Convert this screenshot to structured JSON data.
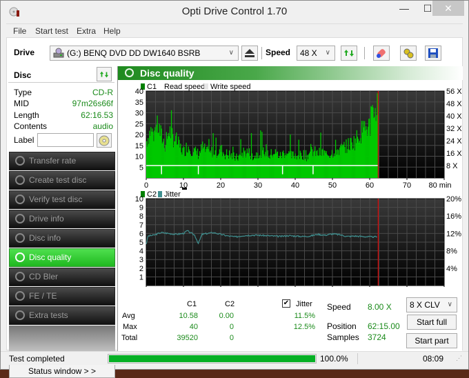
{
  "window": {
    "title": "Opti Drive Control 1.70",
    "controls": {
      "minimize": "—",
      "maximize": "☐",
      "close": "✕"
    }
  },
  "menu": [
    "File",
    "Start test",
    "Extra",
    "Help"
  ],
  "toolbar": {
    "drive_label": "Drive",
    "drive_value": "(G:)  BENQ DVD DD DW1640 BSRB",
    "speed_label": "Speed",
    "speed_value": "48 X",
    "icons": [
      "eject-icon",
      "refresh-icon",
      "erase-icon",
      "settings-icon",
      "save-icon"
    ]
  },
  "disc": {
    "header": "Disc",
    "fields": [
      {
        "key": "Type",
        "value": "CD-R"
      },
      {
        "key": "MID",
        "value": "97m26s66f"
      },
      {
        "key": "Length",
        "value": "62:16.53"
      },
      {
        "key": "Contents",
        "value": "audio"
      }
    ],
    "label_key": "Label",
    "label_value": ""
  },
  "nav": [
    {
      "label": "Transfer rate",
      "active": false
    },
    {
      "label": "Create test disc",
      "active": false
    },
    {
      "label": "Verify test disc",
      "active": false
    },
    {
      "label": "Drive info",
      "active": false
    },
    {
      "label": "Disc info",
      "active": false
    },
    {
      "label": "Disc quality",
      "active": true
    },
    {
      "label": "CD Bler",
      "active": false
    },
    {
      "label": "FE / TE",
      "active": false
    },
    {
      "label": "Extra tests",
      "active": false
    }
  ],
  "status_window_button": "Status window > >",
  "panel_title": "Disc quality",
  "chart_data": [
    {
      "type": "bar",
      "title": "C1",
      "legend": [
        "C1",
        "Read speed",
        "Write speed"
      ],
      "legend_colors": {
        "C1": "#00c000",
        "Read speed": "#ffffff",
        "Write speed": "#e6e6e6"
      },
      "xlabel": "min",
      "x_ticks": [
        "0",
        "10",
        "20",
        "30",
        "40",
        "50",
        "60",
        "70",
        "80 min"
      ],
      "xlim": [
        0,
        80
      ],
      "y_left_ticks": [
        "5",
        "10",
        "15",
        "20",
        "25",
        "30",
        "35",
        "40"
      ],
      "ylim_left": [
        0,
        40
      ],
      "y_right_ticks": [
        "8 X",
        "16 X",
        "24 X",
        "32 X",
        "40 X",
        "48 X",
        "56 X"
      ],
      "ylim_right": [
        0,
        56
      ],
      "end_marker_min": 62.28,
      "read_speed_x": 8,
      "read_speed_dips_min": [
        4.1,
        14.0,
        36.6,
        44.8
      ],
      "c1_envelope": [
        [
          0,
          17
        ],
        [
          1,
          22
        ],
        [
          2,
          20
        ],
        [
          3,
          24
        ],
        [
          4,
          19
        ],
        [
          5,
          15
        ],
        [
          6,
          22
        ],
        [
          7,
          19
        ],
        [
          8,
          17
        ],
        [
          9,
          14
        ],
        [
          10,
          12
        ],
        [
          11,
          15
        ],
        [
          12,
          13
        ],
        [
          13,
          12
        ],
        [
          14,
          11
        ],
        [
          15,
          14
        ],
        [
          16,
          12
        ],
        [
          17,
          11
        ],
        [
          18,
          13
        ],
        [
          19,
          12
        ],
        [
          20,
          13
        ],
        [
          21,
          11
        ],
        [
          22,
          11
        ],
        [
          23,
          10
        ],
        [
          24,
          9
        ],
        [
          25,
          10
        ],
        [
          26,
          12
        ],
        [
          27,
          12
        ],
        [
          28,
          11
        ],
        [
          29,
          10
        ],
        [
          30,
          12
        ],
        [
          31,
          11
        ],
        [
          32,
          13
        ],
        [
          33,
          10
        ],
        [
          34,
          12
        ],
        [
          35,
          11
        ],
        [
          36,
          10
        ],
        [
          37,
          12
        ],
        [
          38,
          11
        ],
        [
          39,
          10
        ],
        [
          40,
          11
        ],
        [
          41,
          10
        ],
        [
          42,
          11
        ],
        [
          43,
          10
        ],
        [
          44,
          12
        ],
        [
          45,
          12
        ],
        [
          46,
          11
        ],
        [
          47,
          12
        ],
        [
          48,
          11
        ],
        [
          49,
          11
        ],
        [
          50,
          12
        ],
        [
          51,
          13
        ],
        [
          52,
          13
        ],
        [
          53,
          14
        ],
        [
          54,
          15
        ],
        [
          55,
          16
        ],
        [
          56,
          17
        ],
        [
          57,
          20
        ],
        [
          58,
          22
        ],
        [
          59,
          23
        ],
        [
          60,
          24
        ],
        [
          61,
          30
        ],
        [
          62,
          33
        ]
      ]
    },
    {
      "type": "line",
      "title": "C2 / Jitter",
      "legend": [
        "C2",
        "Jitter"
      ],
      "legend_colors": {
        "C2": "#008000",
        "Jitter": "#3f8f8f"
      },
      "xlabel": "min",
      "x_ticks": [
        "0",
        "10",
        "20",
        "30",
        "40",
        "50",
        "60",
        "70",
        "80 min"
      ],
      "xlim": [
        0,
        80
      ],
      "y_left_ticks": [
        "1",
        "2",
        "3",
        "4",
        "5",
        "6",
        "7",
        "8",
        "9",
        "10"
      ],
      "ylim_left": [
        0,
        10
      ],
      "y_right_ticks": [
        "4%",
        "8%",
        "12%",
        "16%",
        "20%"
      ],
      "ylim_right": [
        0,
        20
      ],
      "end_marker_min": 62.28,
      "c2_values": "all 0",
      "jitter_percent": [
        [
          0,
          9.6
        ],
        [
          0.5,
          11.4
        ],
        [
          2,
          11.6
        ],
        [
          4,
          12.2
        ],
        [
          6,
          12.0
        ],
        [
          8,
          11.8
        ],
        [
          10,
          12.0
        ],
        [
          11,
          12.6
        ],
        [
          13,
          11.6
        ],
        [
          14,
          9.7
        ],
        [
          15,
          11.8
        ],
        [
          18,
          12.2
        ],
        [
          20,
          11.8
        ],
        [
          22,
          11.4
        ],
        [
          24,
          11.2
        ],
        [
          26,
          11.5
        ],
        [
          28,
          11.6
        ],
        [
          30,
          11.6
        ],
        [
          32,
          11.5
        ],
        [
          34,
          11.4
        ],
        [
          36,
          11.3
        ],
        [
          38,
          11.5
        ],
        [
          40,
          11.4
        ],
        [
          42,
          11.3
        ],
        [
          44,
          11.4
        ],
        [
          46,
          11.8
        ],
        [
          48,
          11.6
        ],
        [
          50,
          11.9
        ],
        [
          52,
          11.7
        ],
        [
          54,
          11.3
        ],
        [
          56,
          11.4
        ],
        [
          58,
          11.3
        ],
        [
          60,
          11.2
        ],
        [
          62,
          11.2
        ]
      ]
    }
  ],
  "stats": {
    "col_c1": "C1",
    "col_c2": "C2",
    "jitter_label": "Jitter",
    "jitter_checked": true,
    "rows": [
      {
        "label": "Avg",
        "c1": "10.58",
        "c2": "0.00",
        "jitter": "11.5%"
      },
      {
        "label": "Max",
        "c1": "40",
        "c2": "0",
        "jitter": "12.5%"
      },
      {
        "label": "Total",
        "c1": "39520",
        "c2": "0",
        "jitter": ""
      }
    ]
  },
  "test": {
    "speed_label": "Speed",
    "speed_value": "8.00 X",
    "position_label": "Position",
    "position_value": "62:15.00",
    "samples_label": "Samples",
    "samples_value": "3724",
    "speed_select": "8 X CLV",
    "start_full": "Start full",
    "start_part": "Start part"
  },
  "statusbar": {
    "text": "Test completed",
    "progress": 1.0,
    "progress_text": "100.0%",
    "time": "08:09"
  }
}
